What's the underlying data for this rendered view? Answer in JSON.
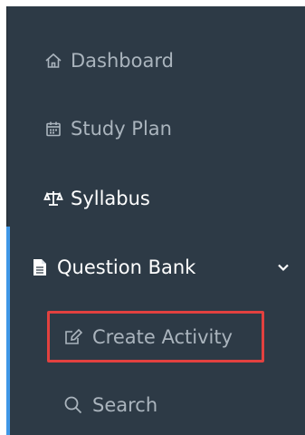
{
  "nav": {
    "items": [
      {
        "label": "Dashboard",
        "icon": "home-icon"
      },
      {
        "label": "Study Plan",
        "icon": "calendar-icon"
      },
      {
        "label": "Syllabus",
        "icon": "balance-scale-icon"
      },
      {
        "label": "Question Bank",
        "icon": "file-icon",
        "expanded": true
      }
    ],
    "subitems": [
      {
        "label": "Create Activity",
        "icon": "edit-icon",
        "highlighted": true
      },
      {
        "label": "Search",
        "icon": "search-icon"
      }
    ]
  },
  "colors": {
    "sidebar_bg": "#2d3a46",
    "accent": "#3f97e6",
    "highlight": "#e2413f",
    "muted_text": "#aab4bd"
  }
}
